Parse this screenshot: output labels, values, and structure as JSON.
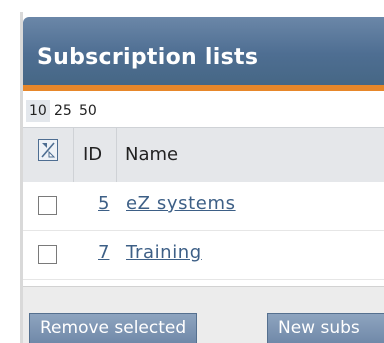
{
  "panel": {
    "title": "Subscription lists"
  },
  "per_page": {
    "options": [
      "10",
      "25",
      "50"
    ],
    "selected": "10"
  },
  "table": {
    "columns": {
      "id": "ID",
      "name": "Name"
    },
    "rows": [
      {
        "id": "5",
        "name": "eZ systems"
      },
      {
        "id": "7",
        "name": "Training"
      }
    ]
  },
  "actions": {
    "remove_selected": "Remove selected",
    "new_subscription": "New subs"
  },
  "colors": {
    "header": "#4e6e92",
    "accent_stripe": "#e7872a",
    "link": "#3d5f86"
  }
}
